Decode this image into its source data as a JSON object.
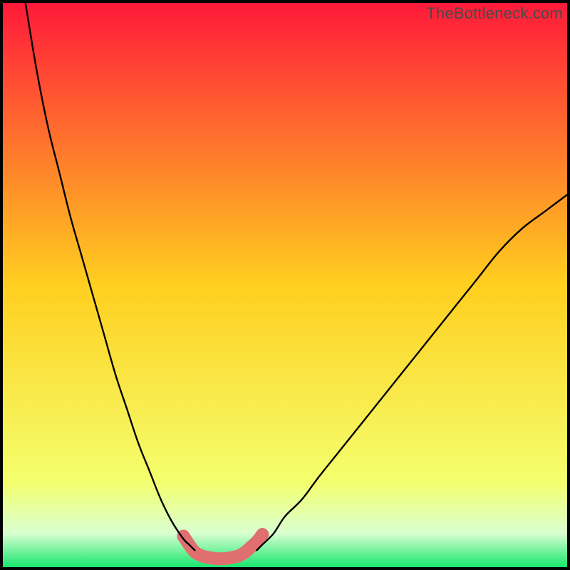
{
  "watermark": "TheBottleneck.com",
  "chart_data": {
    "type": "line",
    "title": "",
    "xlabel": "",
    "ylabel": "",
    "xlim": [
      0,
      100
    ],
    "ylim": [
      0,
      100
    ],
    "series": [
      {
        "name": "left-curve",
        "x": [
          4,
          6,
          8,
          10,
          12,
          14,
          16,
          18,
          20,
          22,
          24,
          26,
          28,
          30,
          32,
          33,
          34
        ],
        "values": [
          100,
          88,
          78,
          70,
          62,
          55,
          48,
          41,
          34,
          28,
          22,
          17,
          12,
          8,
          5,
          4,
          3
        ]
      },
      {
        "name": "right-curve",
        "x": [
          45,
          46,
          48,
          50,
          53,
          56,
          60,
          64,
          68,
          72,
          76,
          80,
          84,
          88,
          92,
          96,
          100
        ],
        "values": [
          3,
          4,
          6,
          9,
          12,
          16,
          21,
          26,
          31,
          36,
          41,
          46,
          51,
          56,
          60,
          63,
          66
        ]
      },
      {
        "name": "trough-highlight",
        "x": [
          32,
          33,
          34,
          35,
          36,
          37,
          38,
          39,
          40,
          41,
          42,
          43,
          44,
          45,
          46
        ],
        "values": [
          5.5,
          4,
          2.7,
          2.1,
          1.8,
          1.6,
          1.5,
          1.5,
          1.6,
          1.8,
          2.1,
          2.7,
          3.6,
          4.5,
          5.8
        ]
      }
    ],
    "gradient_bands": [
      {
        "y": 100,
        "color": "#ff1a3a"
      },
      {
        "y": 50,
        "color": "#ffcf1f"
      },
      {
        "y": 15,
        "color": "#f4ff6e"
      },
      {
        "y": 6,
        "color": "#d9ffd0"
      },
      {
        "y": 0,
        "color": "#17e66e"
      }
    ],
    "frame_inset": {
      "top": 4,
      "right": 4,
      "bottom": 4,
      "left": 4
    }
  }
}
